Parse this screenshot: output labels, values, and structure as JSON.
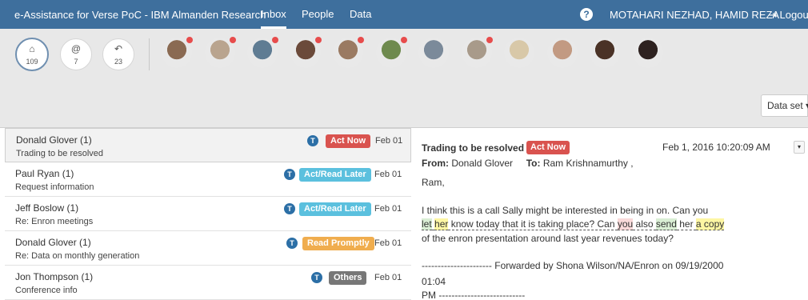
{
  "navbar": {
    "brand": "e-Assistance for Verse PoC - IBM Almanden Research",
    "tabs": [
      "Inbox",
      "People",
      "Data"
    ],
    "help_icon": "?",
    "user": "MOTAHARI NEZHAD, HAMID REZA",
    "logout": "Logout"
  },
  "folders": [
    {
      "icon": "home-icon",
      "glyph": "⌂",
      "count": "109"
    },
    {
      "icon": "at-icon",
      "glyph": "@",
      "count": "7"
    },
    {
      "icon": "reply-icon",
      "glyph": "↶",
      "count": "23"
    }
  ],
  "contacts": [
    {
      "name": "contact-1",
      "color": "#8a6a52",
      "unread": true
    },
    {
      "name": "contact-2",
      "color": "#b9a48e",
      "unread": true
    },
    {
      "name": "contact-3",
      "color": "#5f7c93",
      "unread": true
    },
    {
      "name": "contact-4",
      "color": "#6b4a3a",
      "unread": true
    },
    {
      "name": "contact-5",
      "color": "#9a7a62",
      "unread": true
    },
    {
      "name": "contact-6",
      "color": "#6e8a4e",
      "unread": true
    },
    {
      "name": "contact-7",
      "color": "#7b8a9a",
      "unread": false
    },
    {
      "name": "contact-8",
      "color": "#a89a8a",
      "unread": true
    },
    {
      "name": "contact-9",
      "color": "#d8c8a8",
      "unread": false
    },
    {
      "name": "contact-10",
      "color": "#c29a82",
      "unread": false
    },
    {
      "name": "contact-11",
      "color": "#4a3226",
      "unread": false
    },
    {
      "name": "contact-12",
      "color": "#2e2220",
      "unread": false
    }
  ],
  "dataset_button": "Data set ▾",
  "emails": [
    {
      "sender": "Donald Glover (1)",
      "subject": "Trading to be resolved",
      "label": "Act Now",
      "label_color": "#d9534f",
      "date": "Feb 01"
    },
    {
      "sender": "Paul Ryan (1)",
      "subject": "Request information",
      "label": "Act/Read Later",
      "label_color": "#5bc0de",
      "date": "Feb 01"
    },
    {
      "sender": "Jeff Boslow (1)",
      "subject": "Re: Enron meetings",
      "label": "Act/Read Later",
      "label_color": "#5bc0de",
      "date": "Feb 01"
    },
    {
      "sender": "Donald Glover (1)",
      "subject": "Re: Data on monthly generation",
      "label": "Read Promptly",
      "label_color": "#f0ad4e",
      "date": "Feb 01"
    },
    {
      "sender": "Jon Thompson (1)",
      "subject": "Conference info",
      "label": "Others",
      "label_color": "#777777",
      "date": "Feb 01"
    }
  ],
  "t_badge": "T",
  "preview": {
    "subject": "Trading to be resolved",
    "label": "Act Now",
    "datetime": "Feb 1, 2016 10:20:09 AM",
    "caret": "▾",
    "from_label": "From:",
    "from": "Donald Glover",
    "to_label": "To:",
    "to": "Ram Krishnamurthy ,",
    "greeting": "Ram,",
    "line1": "I think this is a call Sally might be interested in being in on. Can you",
    "line2_parts": [
      "let",
      " ",
      "her",
      " know today that it is taking place? Can ",
      "you",
      " also ",
      "send",
      " her ",
      "a copy"
    ],
    "line3": "of the enron presentation around last year revenues today?",
    "forward1": "---------------------- Forwarded by Shona Wilson/NA/Enron on 09/19/2000",
    "forward2": "01:04",
    "forward3": "PM ---------------------------"
  }
}
